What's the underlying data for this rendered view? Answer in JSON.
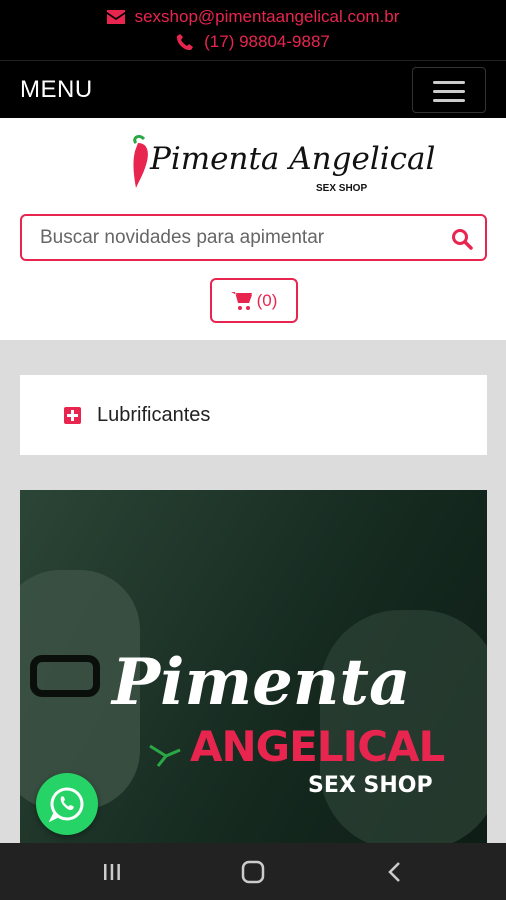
{
  "topbar": {
    "email": "sexshop@pimentaangelical.com.br",
    "phone": "(17) 98804-9887",
    "accent_color": "#e8254f"
  },
  "menubar": {
    "label": "MENU",
    "toggle_icon": "hamburger-icon"
  },
  "logo": {
    "script_text": "Pimenta Angelical",
    "subtitle": "SEX SHOP"
  },
  "search": {
    "placeholder": "Buscar novidades para apimentar",
    "icon": "search-icon"
  },
  "cart": {
    "count_label": "(0)",
    "icon": "cart-icon"
  },
  "category": {
    "label": "Lubrificantes",
    "icon": "plus-square-icon"
  },
  "banner": {
    "line1": "Pimenta",
    "line2": "ANGELICAL",
    "line3": "SEX SHOP"
  },
  "whatsapp": {
    "icon": "whatsapp-icon",
    "color": "#25d366"
  },
  "system_nav": {
    "icons": [
      "recents-icon",
      "home-icon",
      "back-icon"
    ]
  }
}
